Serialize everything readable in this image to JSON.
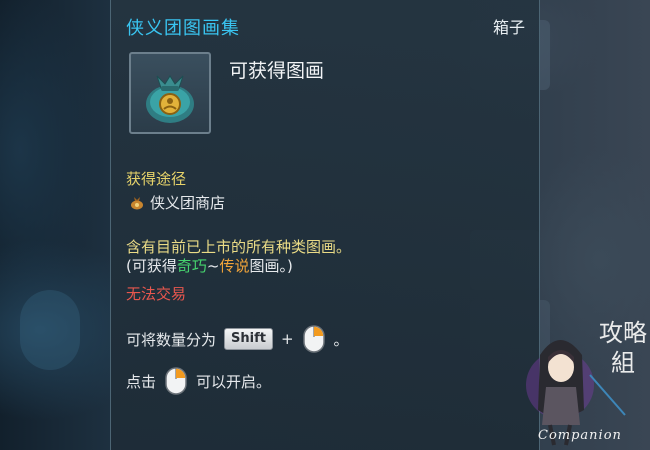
{
  "tooltip": {
    "title": "侠义团图画集",
    "category": "箱子",
    "item_name": "可获得图画",
    "item_icon": "money-bag-icon",
    "acquire_heading": "获得途径",
    "acquire_source": "侠义团商店",
    "acquire_source_icon": "pouch-icon",
    "description_line1": "含有目前已上市的所有种类图画。",
    "description_line2_prefix": "(可获得",
    "grade_rare": "奇巧",
    "grade_sep": "~",
    "grade_legend": "传说",
    "description_line2_suffix": "图画。)",
    "trade_status": "无法交易",
    "split_hint_prefix": "可将数量分为",
    "split_key": "Shift",
    "split_plus": "+",
    "split_suffix": "。",
    "open_hint_prefix": "点击",
    "open_hint_suffix": "可以开启。",
    "mouse_icon": "mouse-right-click-icon"
  },
  "watermark": {
    "text": "Companion",
    "calligraphy": "攻略組"
  },
  "colors": {
    "title": "#39c4f0",
    "heading": "#e7d36a",
    "rare": "#46d56e",
    "legend": "#f0a43a",
    "untradeable": "#e8574e"
  }
}
